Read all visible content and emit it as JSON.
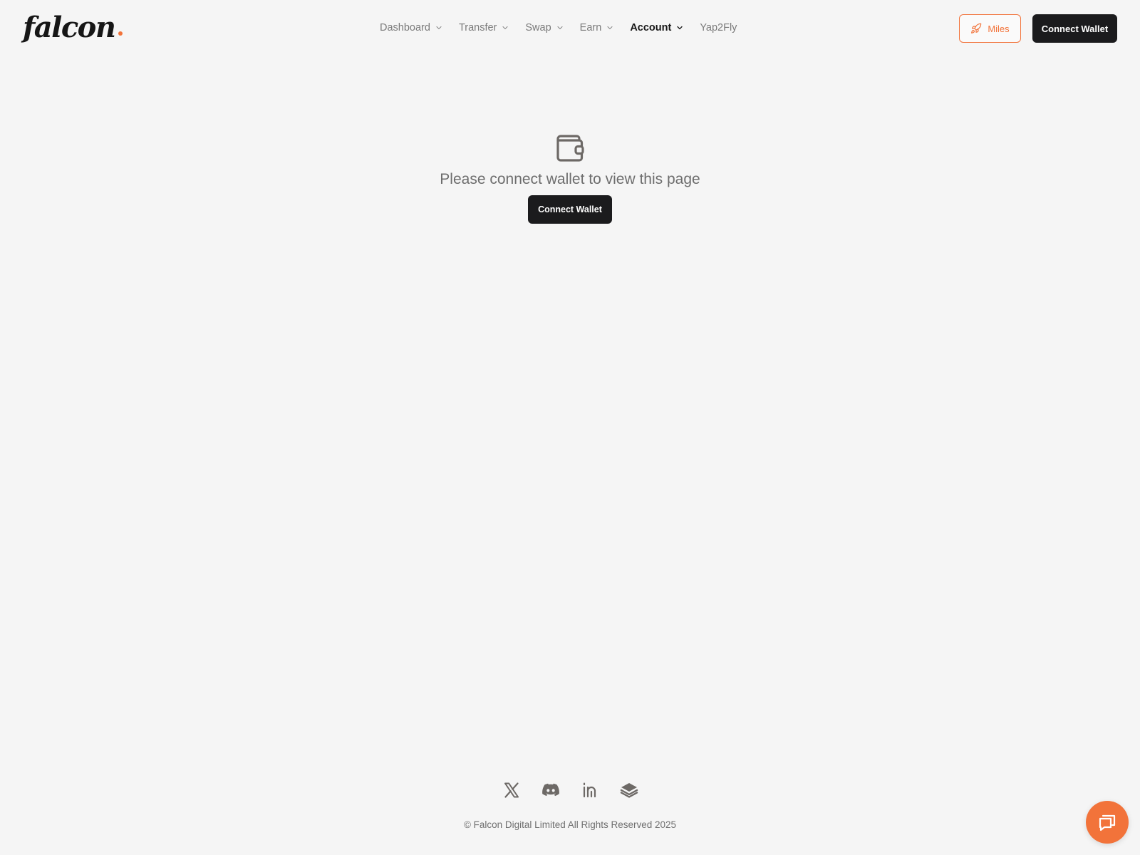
{
  "colors": {
    "accent": "#f2733a",
    "dark_button": "#1b1b1d",
    "background": "#f5f5f5",
    "muted_text": "#7a7a7a",
    "icon_gray": "#6d6966"
  },
  "header": {
    "logo_text": "falcon",
    "nav": [
      {
        "label": "Dashboard",
        "has_dropdown": true,
        "active": false
      },
      {
        "label": "Transfer",
        "has_dropdown": true,
        "active": false
      },
      {
        "label": "Swap",
        "has_dropdown": true,
        "active": false
      },
      {
        "label": "Earn",
        "has_dropdown": true,
        "active": false
      },
      {
        "label": "Account",
        "has_dropdown": true,
        "active": true
      },
      {
        "label": "Yap2Fly",
        "has_dropdown": false,
        "active": false
      }
    ],
    "miles_label": "Miles",
    "miles_icon": "rocket-icon",
    "connect_label": "Connect Wallet"
  },
  "main": {
    "icon": "wallet-icon",
    "message": "Please connect wallet to view this page",
    "connect_label": "Connect Wallet"
  },
  "footer": {
    "socials": [
      {
        "name": "x-icon"
      },
      {
        "name": "discord-icon"
      },
      {
        "name": "linkedin-icon"
      },
      {
        "name": "gitbook-icon"
      }
    ],
    "copyright": "© Falcon Digital Limited All Rights Reserved 2025"
  },
  "chat": {
    "icon": "chat-icon"
  }
}
